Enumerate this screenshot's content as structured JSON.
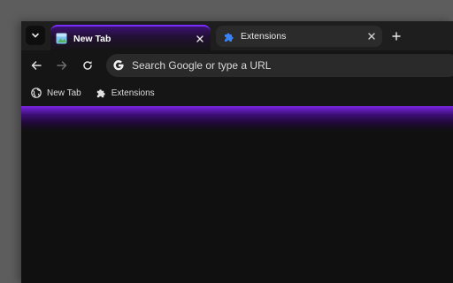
{
  "tabs": [
    {
      "title": "New Tab",
      "active": true,
      "favicon": "new-tab-icon"
    },
    {
      "title": "Extensions",
      "active": false,
      "favicon": "puzzle-icon"
    }
  ],
  "toolbar": {
    "omnibox_placeholder": "Search Google or type a URL",
    "back_icon": "back-arrow-icon",
    "forward_icon": "forward-arrow-icon",
    "reload_icon": "reload-icon"
  },
  "bookmarks": [
    {
      "label": "New Tab",
      "icon": "globe-icon"
    },
    {
      "label": "Extensions",
      "icon": "puzzle-icon"
    }
  ],
  "colors": {
    "accent": "#7a2cff",
    "window_bg": "#101010",
    "toolbar_bg": "#151515",
    "desktop_bg": "#5d5d5d"
  }
}
